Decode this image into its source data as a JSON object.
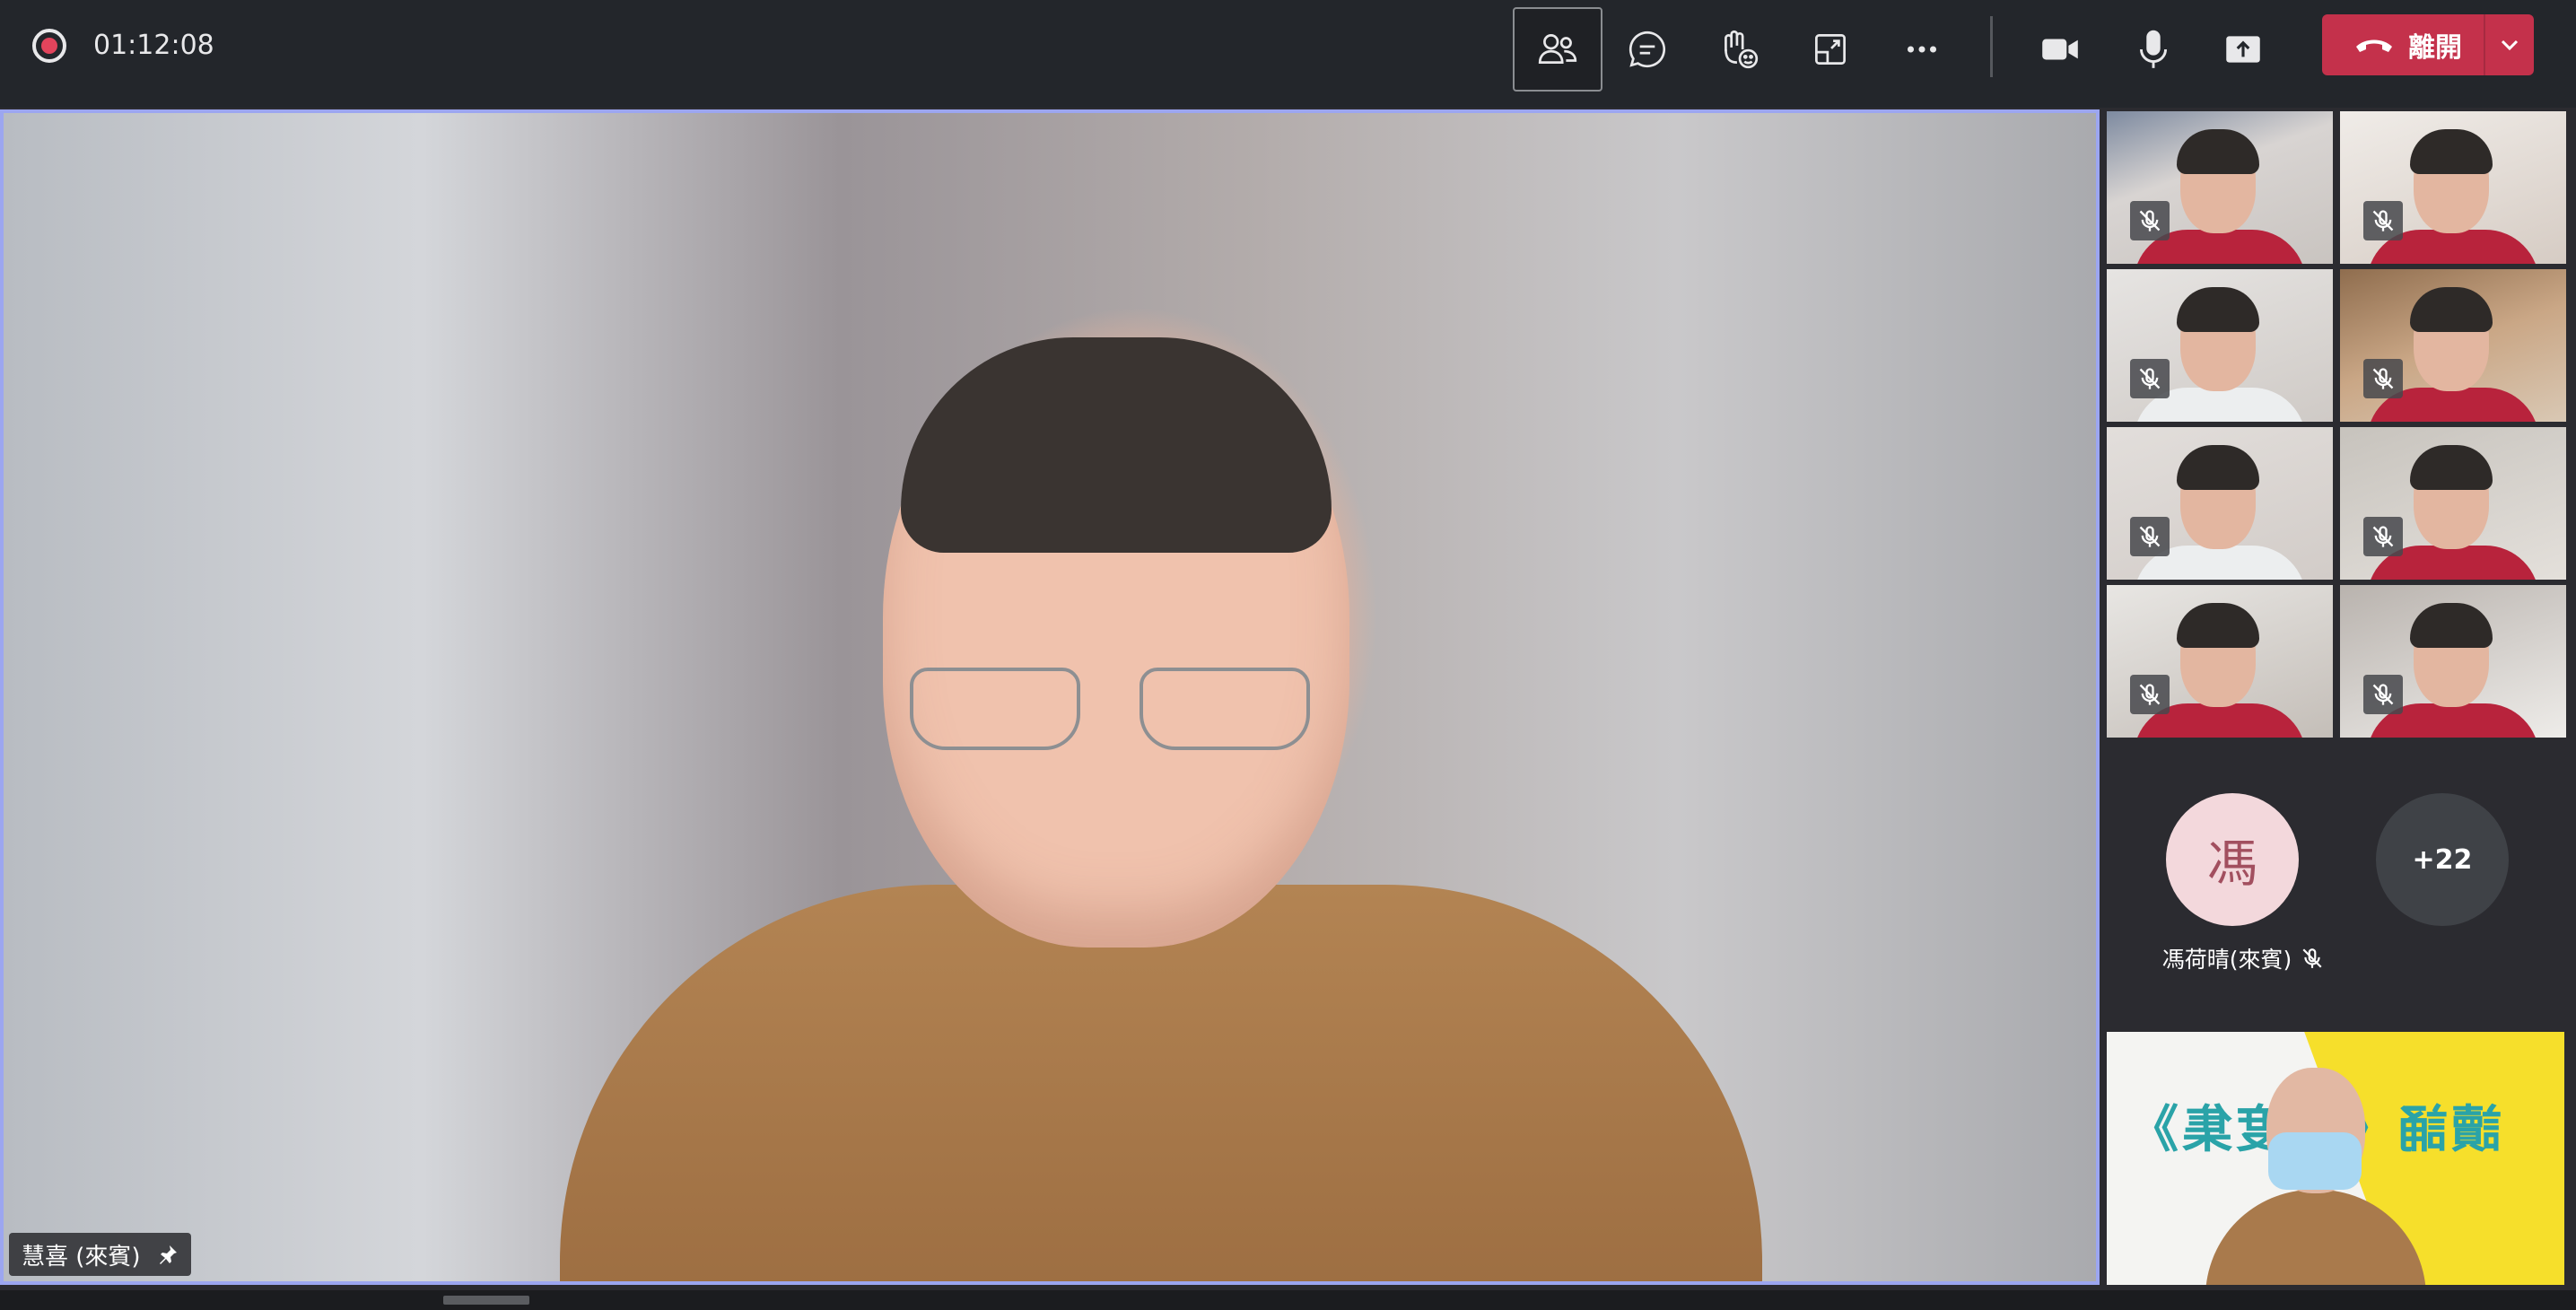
{
  "call": {
    "recording_timer": "01:12:08"
  },
  "toolbar": {
    "buttons": [
      {
        "name": "participants-button",
        "icon": "people-icon",
        "active": true
      },
      {
        "name": "chat-button",
        "icon": "chat-bubble-icon",
        "active": false
      },
      {
        "name": "reactions-button",
        "icon": "raise-hand-icon",
        "active": false
      },
      {
        "name": "view-button",
        "icon": "layout-icon",
        "active": false
      },
      {
        "name": "more-actions-button",
        "icon": "ellipsis-icon",
        "active": false
      },
      {
        "name": "camera-button",
        "icon": "camera-icon",
        "active": false
      },
      {
        "name": "mic-button",
        "icon": "microphone-icon",
        "active": false
      },
      {
        "name": "share-button",
        "icon": "share-tray-icon",
        "active": false
      }
    ],
    "leave_label": "離開"
  },
  "main_speaker": {
    "name_label": "慧喜 (來賓)",
    "pinned": true
  },
  "participants_grid": {
    "tiles": [
      {
        "muted": true,
        "shirt": "red"
      },
      {
        "muted": true,
        "shirt": "red"
      },
      {
        "muted": true,
        "shirt": "white"
      },
      {
        "muted": true,
        "shirt": "red"
      },
      {
        "muted": true,
        "shirt": "white"
      },
      {
        "muted": true,
        "shirt": "red"
      },
      {
        "muted": true,
        "shirt": "red"
      },
      {
        "muted": true,
        "shirt": "red"
      }
    ]
  },
  "avatar_participant": {
    "initial": "馮",
    "name": "馮荷晴(來賓)",
    "muted": true
  },
  "overflow": {
    "label": "+22"
  },
  "self_view": {
    "background_text": "讀誦《六度集》"
  },
  "colors": {
    "topbar": "#23262b",
    "leave": "#c4314b",
    "stage_border": "#9ca6f0",
    "record": "#e2445c"
  }
}
